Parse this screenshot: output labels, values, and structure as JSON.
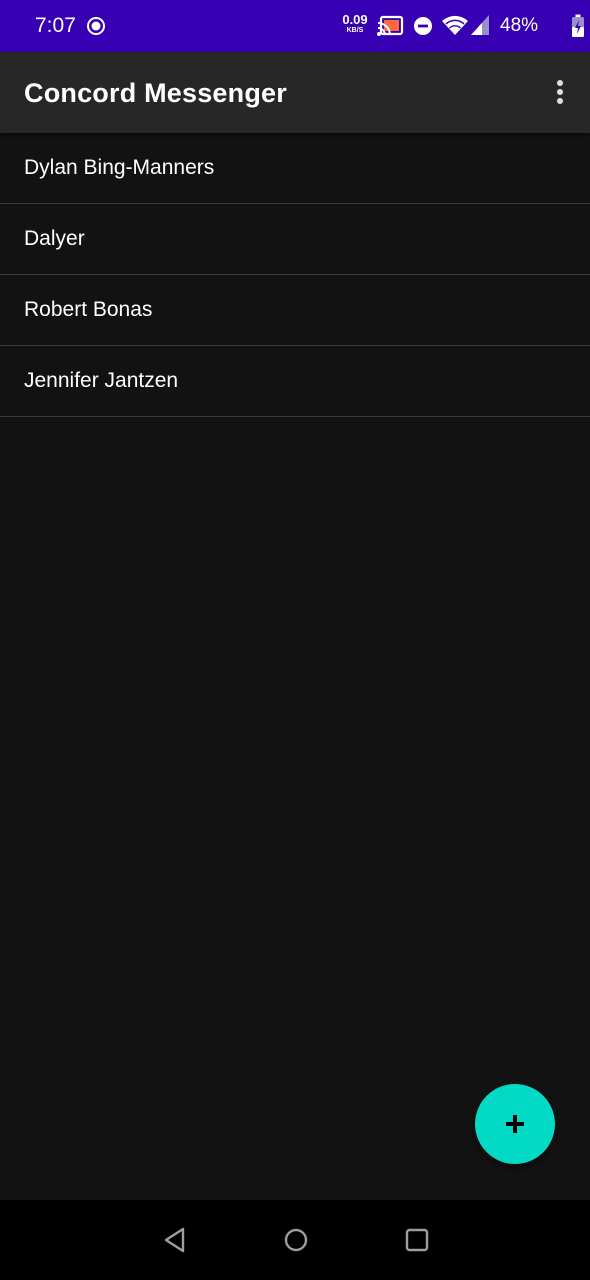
{
  "status_bar": {
    "time": "7:07",
    "net_speed_value": "0.09",
    "net_speed_unit": "KB/S",
    "battery_percent": "48%",
    "icons": [
      "record-icon",
      "cast-icon",
      "do-not-disturb-icon",
      "wifi-icon",
      "cell-signal-icon",
      "battery-charging-icon"
    ]
  },
  "app_bar": {
    "title": "Concord Messenger",
    "menu_icon": "more-vert-icon"
  },
  "contacts": [
    {
      "name": "Dylan Bing-Manners"
    },
    {
      "name": "Dalyer"
    },
    {
      "name": "Robert Bonas"
    },
    {
      "name": "Jennifer Jantzen"
    }
  ],
  "fab": {
    "icon": "add-icon"
  },
  "nav_bar": {
    "icons": [
      "back-icon",
      "home-icon",
      "recents-icon"
    ]
  },
  "colors": {
    "status_bar": "#3700b3",
    "app_bar": "#272727",
    "background": "#121212",
    "fab": "#03dac5",
    "divider": "#3a3a3a"
  }
}
